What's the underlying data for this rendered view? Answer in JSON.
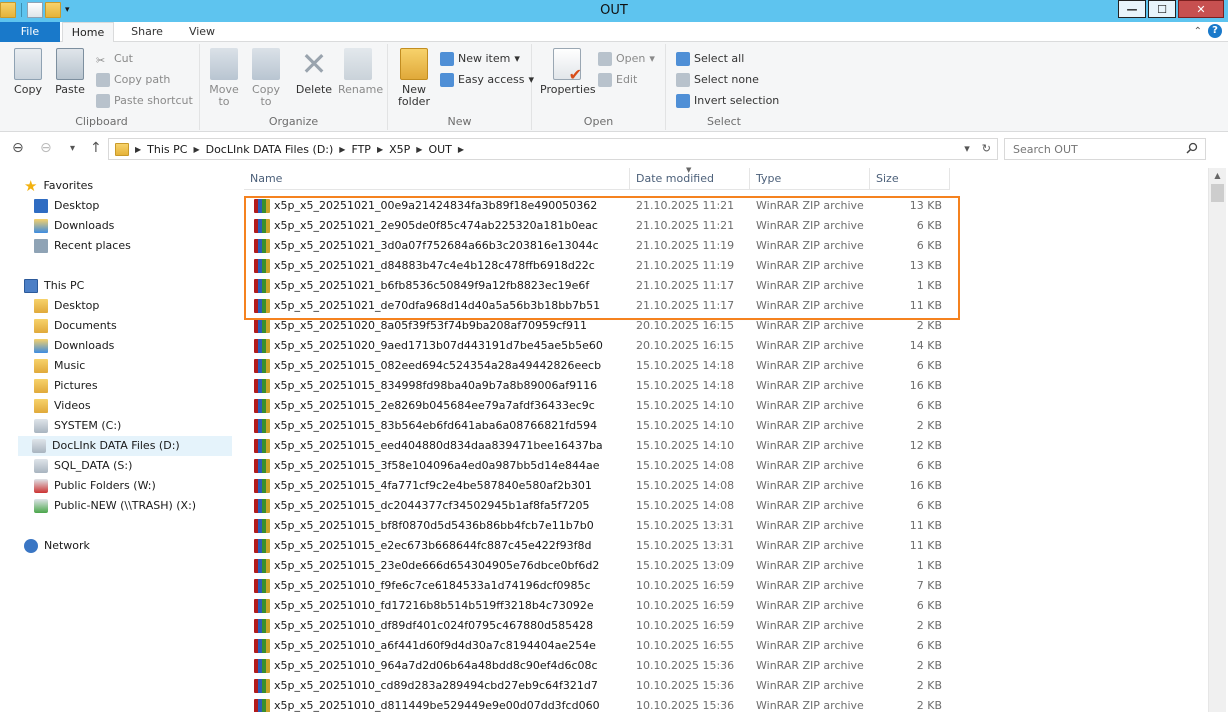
{
  "window": {
    "title": "OUT"
  },
  "ribbon_tabs": {
    "file": "File",
    "home": "Home",
    "share": "Share",
    "view": "View"
  },
  "ribbon": {
    "clipboard": {
      "label": "Clipboard",
      "copy": "Copy",
      "paste": "Paste",
      "cut": "Cut",
      "copy_path": "Copy path",
      "paste_shortcut": "Paste shortcut"
    },
    "organize": {
      "label": "Organize",
      "move_to": "Move to",
      "copy_to": "Copy to",
      "delete": "Delete",
      "rename": "Rename"
    },
    "new": {
      "label": "New",
      "new_folder": "New folder",
      "new_item": "New item",
      "easy_access": "Easy access"
    },
    "open": {
      "label": "Open",
      "properties": "Properties",
      "open": "Open",
      "edit": "Edit"
    },
    "select": {
      "label": "Select",
      "select_all": "Select all",
      "select_none": "Select none",
      "invert": "Invert selection"
    }
  },
  "address": {
    "crumbs": [
      "This PC",
      "DocLInk DATA Files (D:)",
      "FTP",
      "X5P",
      "OUT"
    ],
    "search_placeholder": "Search OUT"
  },
  "nav": {
    "favorites": "Favorites",
    "fav_items": [
      "Desktop",
      "Downloads",
      "Recent places"
    ],
    "this_pc": "This PC",
    "pc_items": [
      "Desktop",
      "Documents",
      "Downloads",
      "Music",
      "Pictures",
      "Videos",
      "SYSTEM (C:)",
      "DocLInk DATA Files (D:)",
      "SQL_DATA (S:)",
      "Public Folders (W:)",
      "Public-NEW (\\\\TRASH) (X:)"
    ],
    "network": "Network"
  },
  "columns": {
    "name": "Name",
    "date": "Date modified",
    "type": "Type",
    "size": "Size"
  },
  "files": [
    [
      "x5p_x5_20251021_00e9a21424834fa3b89f18e490050362",
      "21.10.2025 11:21",
      "WinRAR ZIP archive",
      "13 KB"
    ],
    [
      "x5p_x5_20251021_2e905de0f85c474ab225320a181b0eac",
      "21.10.2025 11:21",
      "WinRAR ZIP archive",
      "6 KB"
    ],
    [
      "x5p_x5_20251021_3d0a07f752684a66b3c203816e13044c",
      "21.10.2025 11:19",
      "WinRAR ZIP archive",
      "6 KB"
    ],
    [
      "x5p_x5_20251021_d84883b47c4e4b128c478ffb6918d22c",
      "21.10.2025 11:19",
      "WinRAR ZIP archive",
      "13 KB"
    ],
    [
      "x5p_x5_20251021_b6fb8536c50849f9a12fb8823ec19e6f",
      "21.10.2025 11:17",
      "WinRAR ZIP archive",
      "1 KB"
    ],
    [
      "x5p_x5_20251021_de70dfa968d14d40a5a56b3b18bb7b51",
      "21.10.2025 11:17",
      "WinRAR ZIP archive",
      "11 KB"
    ],
    [
      "x5p_x5_20251020_8a05f39f53f74b9ba208af70959cf911",
      "20.10.2025 16:15",
      "WinRAR ZIP archive",
      "2 KB"
    ],
    [
      "x5p_x5_20251020_9aed1713b07d443191d7be45ae5b5e60",
      "20.10.2025 16:15",
      "WinRAR ZIP archive",
      "14 KB"
    ],
    [
      "x5p_x5_20251015_082eed694c524354a28a49442826eecb",
      "15.10.2025 14:18",
      "WinRAR ZIP archive",
      "6 KB"
    ],
    [
      "x5p_x5_20251015_834998fd98ba40a9b7a8b89006af9116",
      "15.10.2025 14:18",
      "WinRAR ZIP archive",
      "16 KB"
    ],
    [
      "x5p_x5_20251015_2e8269b045684ee79a7afdf36433ec9c",
      "15.10.2025 14:10",
      "WinRAR ZIP archive",
      "6 KB"
    ],
    [
      "x5p_x5_20251015_83b564eb6fd641aba6a08766821fd594",
      "15.10.2025 14:10",
      "WinRAR ZIP archive",
      "2 KB"
    ],
    [
      "x5p_x5_20251015_eed404880d834daa839471bee16437ba",
      "15.10.2025 14:10",
      "WinRAR ZIP archive",
      "12 KB"
    ],
    [
      "x5p_x5_20251015_3f58e104096a4ed0a987bb5d14e844ae",
      "15.10.2025 14:08",
      "WinRAR ZIP archive",
      "6 KB"
    ],
    [
      "x5p_x5_20251015_4fa771cf9c2e4be587840e580af2b301",
      "15.10.2025 14:08",
      "WinRAR ZIP archive",
      "16 KB"
    ],
    [
      "x5p_x5_20251015_dc2044377cf34502945b1af8fa5f7205",
      "15.10.2025 14:08",
      "WinRAR ZIP archive",
      "6 KB"
    ],
    [
      "x5p_x5_20251015_bf8f0870d5d5436b86bb4fcb7e11b7b0",
      "15.10.2025 13:31",
      "WinRAR ZIP archive",
      "11 KB"
    ],
    [
      "x5p_x5_20251015_e2ec673b668644fc887c45e422f93f8d",
      "15.10.2025 13:31",
      "WinRAR ZIP archive",
      "11 KB"
    ],
    [
      "x5p_x5_20251015_23e0de666d654304905e76dbce0bf6d2",
      "15.10.2025 13:09",
      "WinRAR ZIP archive",
      "1 KB"
    ],
    [
      "x5p_x5_20251010_f9fe6c7ce6184533a1d74196dcf0985c",
      "10.10.2025 16:59",
      "WinRAR ZIP archive",
      "7 KB"
    ],
    [
      "x5p_x5_20251010_fd17216b8b514b519ff3218b4c73092e",
      "10.10.2025 16:59",
      "WinRAR ZIP archive",
      "6 KB"
    ],
    [
      "x5p_x5_20251010_df89df401c024f0795c467880d585428",
      "10.10.2025 16:59",
      "WinRAR ZIP archive",
      "2 KB"
    ],
    [
      "x5p_x5_20251010_a6f441d60f9d4d30a7c8194404ae254e",
      "10.10.2025 16:55",
      "WinRAR ZIP archive",
      "6 KB"
    ],
    [
      "x5p_x5_20251010_964a7d2d06b64a48bdd8c90ef4d6c08c",
      "10.10.2025 15:36",
      "WinRAR ZIP archive",
      "2 KB"
    ],
    [
      "x5p_x5_20251010_cd89d283a289494cbd27eb9c64f321d7",
      "10.10.2025 15:36",
      "WinRAR ZIP archive",
      "2 KB"
    ],
    [
      "x5p_x5_20251010_d811449be529449e9e00d07dd3fcd060",
      "10.10.2025 15:36",
      "WinRAR ZIP archive",
      "2 KB"
    ]
  ]
}
